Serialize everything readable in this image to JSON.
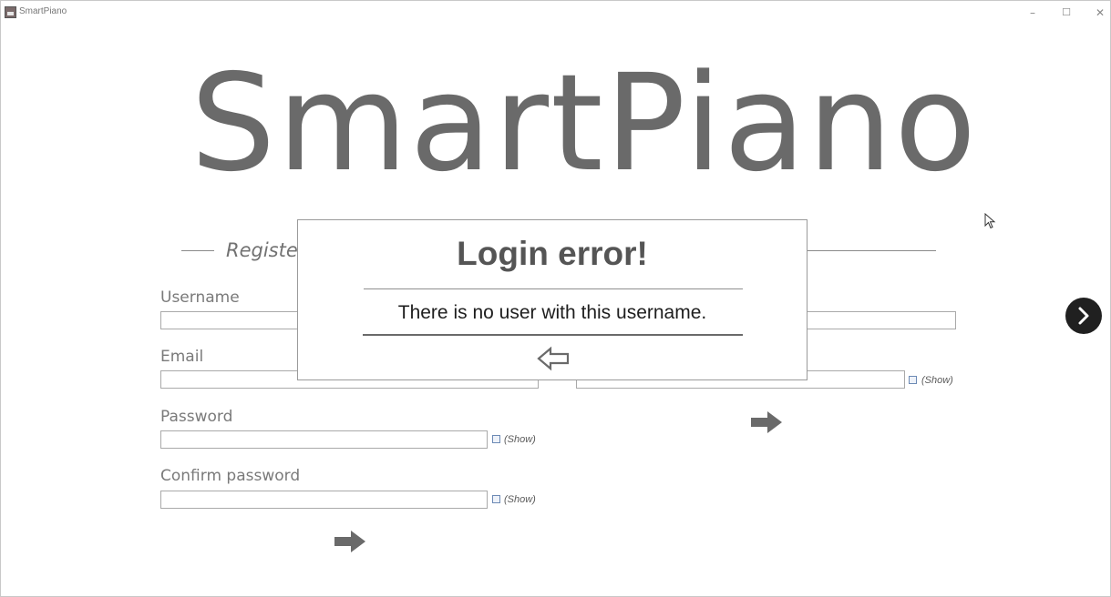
{
  "window": {
    "title": "SmartPiano",
    "controls": {
      "minimize": "–",
      "maximize": "☐",
      "close": "✕"
    }
  },
  "logo": "SmartPiano",
  "register": {
    "title": "Register",
    "username_label": "Username",
    "email_label": "Email",
    "password_label": "Password",
    "confirm_label": "Confirm password",
    "show_label": "(Show)"
  },
  "login": {
    "show_label": "(Show)"
  },
  "dialog": {
    "title": "Login error!",
    "message": "There is no user with this username."
  },
  "icons": {
    "submit": "arrow-right-icon",
    "back": "arrow-left-outline-icon",
    "next": "chevron-right-icon"
  },
  "colors": {
    "logo": "#6a6a6a",
    "arrow": "#6a6a6a",
    "next_button": "#202020",
    "dialog_title": "#555555"
  }
}
